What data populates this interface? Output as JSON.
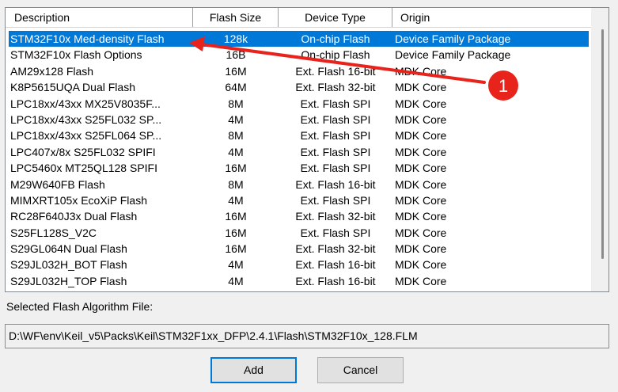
{
  "listview": {
    "columns": {
      "description": "Description",
      "flash_size": "Flash Size",
      "device_type": "Device Type",
      "origin": "Origin"
    },
    "rows": [
      {
        "description": "STM32F10x Med-density Flash",
        "size": "128k",
        "type": "On-chip Flash",
        "origin": "Device Family Package",
        "selected": true
      },
      {
        "description": "STM32F10x Flash Options",
        "size": "16B",
        "type": "On-chip Flash",
        "origin": "Device Family Package"
      },
      {
        "description": "AM29x128 Flash",
        "size": "16M",
        "type": "Ext. Flash 16-bit",
        "origin": "MDK Core"
      },
      {
        "description": "K8P5615UQA Dual Flash",
        "size": "64M",
        "type": "Ext. Flash 32-bit",
        "origin": "MDK Core"
      },
      {
        "description": "LPC18xx/43xx MX25V8035F...",
        "size": "8M",
        "type": "Ext. Flash SPI",
        "origin": "MDK Core"
      },
      {
        "description": "LPC18xx/43xx S25FL032 SP...",
        "size": "4M",
        "type": "Ext. Flash SPI",
        "origin": "MDK Core"
      },
      {
        "description": "LPC18xx/43xx S25FL064 SP...",
        "size": "8M",
        "type": "Ext. Flash SPI",
        "origin": "MDK Core"
      },
      {
        "description": "LPC407x/8x S25FL032 SPIFI",
        "size": "4M",
        "type": "Ext. Flash SPI",
        "origin": "MDK Core"
      },
      {
        "description": "LPC5460x MT25QL128 SPIFI",
        "size": "16M",
        "type": "Ext. Flash SPI",
        "origin": "MDK Core"
      },
      {
        "description": "M29W640FB Flash",
        "size": "8M",
        "type": "Ext. Flash 16-bit",
        "origin": "MDK Core"
      },
      {
        "description": "MIMXRT105x EcoXiP Flash",
        "size": "4M",
        "type": "Ext. Flash SPI",
        "origin": "MDK Core"
      },
      {
        "description": "RC28F640J3x Dual Flash",
        "size": "16M",
        "type": "Ext. Flash 32-bit",
        "origin": "MDK Core"
      },
      {
        "description": "S25FL128S_V2C",
        "size": "16M",
        "type": "Ext. Flash SPI",
        "origin": "MDK Core"
      },
      {
        "description": "S29GL064N Dual Flash",
        "size": "16M",
        "type": "Ext. Flash 32-bit",
        "origin": "MDK Core"
      },
      {
        "description": "S29JL032H_BOT Flash",
        "size": "4M",
        "type": "Ext. Flash 16-bit",
        "origin": "MDK Core"
      },
      {
        "description": "S29JL032H_TOP Flash",
        "size": "4M",
        "type": "Ext. Flash 16-bit",
        "origin": "MDK Core"
      }
    ]
  },
  "selected_file_label": "Selected Flash Algorithm File:",
  "selected_file_path": "D:\\WF\\env\\Keil_v5\\Packs\\Keil\\STM32F1xx_DFP\\2.4.1\\Flash\\STM32F10x_128.FLM",
  "buttons": {
    "add": "Add",
    "cancel": "Cancel"
  },
  "annotation": {
    "badge": "1",
    "color": "#e8231c"
  },
  "colors": {
    "selection": "#0078d7",
    "window": "#f0f0f0"
  }
}
